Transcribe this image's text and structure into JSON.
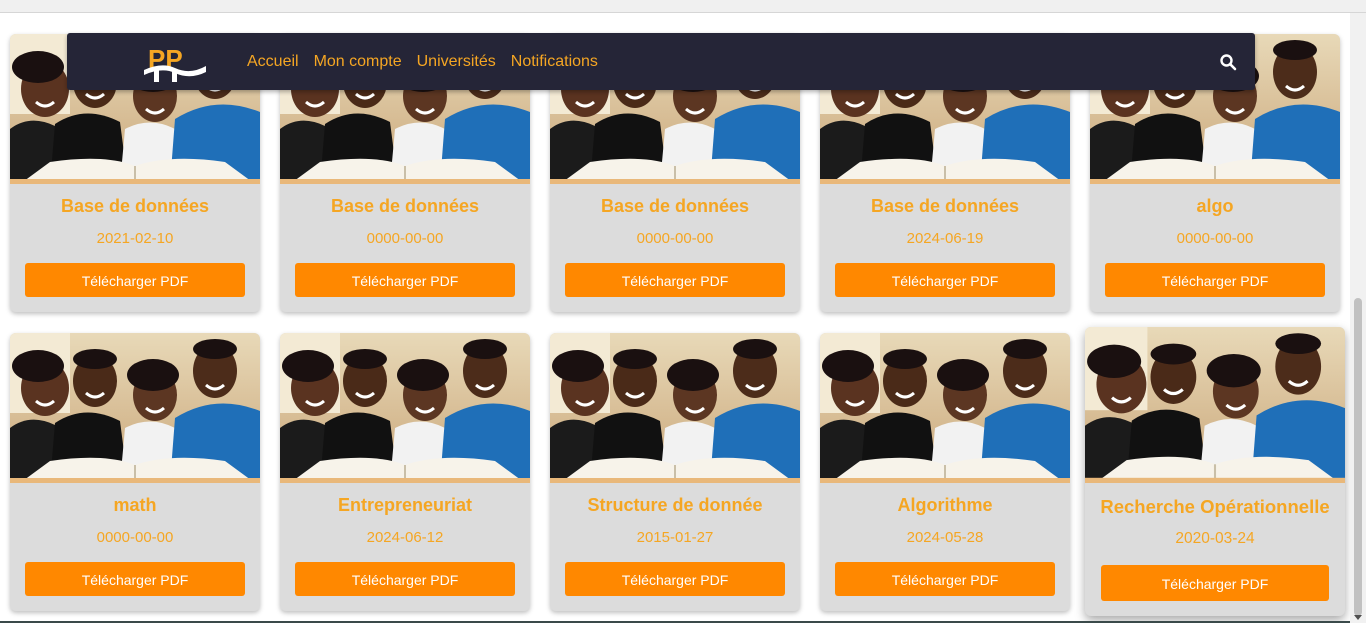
{
  "navbar": {
    "logo_text": "PP",
    "links": [
      "Accueil",
      "Mon compte",
      "Universités",
      "Notifications"
    ],
    "search_icon": "search-icon"
  },
  "colors": {
    "navbar_bg": "#252537",
    "accent": "#f5a623",
    "button": "#ff8800",
    "card_bg": "#dcdcdc"
  },
  "download_label": "Télécharger PDF",
  "cards": [
    {
      "title": "Base de données",
      "date": "2021-02-10"
    },
    {
      "title": "Base de données",
      "date": "0000-00-00"
    },
    {
      "title": "Base de données",
      "date": "0000-00-00"
    },
    {
      "title": "Base de données",
      "date": "2024-06-19"
    },
    {
      "title": "algo",
      "date": "0000-00-00"
    },
    {
      "title": "math",
      "date": "0000-00-00"
    },
    {
      "title": "Entrepreneuriat",
      "date": "2024-06-12"
    },
    {
      "title": "Structure de donnée",
      "date": "2015-01-27"
    },
    {
      "title": "Algorithme",
      "date": "2024-05-28"
    },
    {
      "title": "Recherche Opérationnelle",
      "date": "2020-03-24"
    }
  ]
}
